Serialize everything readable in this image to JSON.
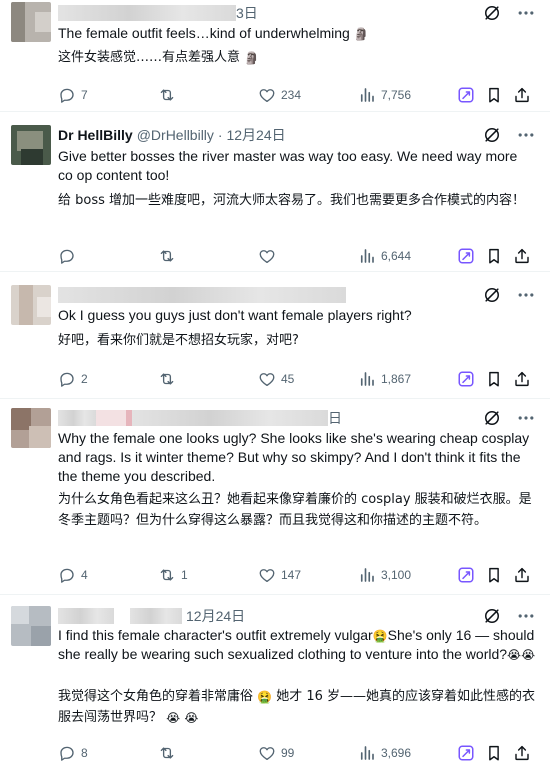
{
  "colors": {
    "text": "#0f1419",
    "muted": "#536471",
    "grok": "#7856ff",
    "divider": "#eff3f4"
  },
  "icons": {
    "more": "more-dots-icon",
    "grok": "grok-icon",
    "reply": "reply-icon",
    "repost": "repost-icon",
    "like": "like-icon",
    "views": "views-icon",
    "bookmark": "bookmark-icon",
    "share": "share-icon",
    "crying": "crying-face-emoji",
    "nauseated": "nauseated-face-emoji",
    "moai": "moai-emoji"
  },
  "posts": [
    {
      "author": "",
      "handle": "",
      "date": "3日",
      "text_en": "The female outfit feels…kind of underwhelming",
      "text_zh": "这件女装感觉……有点差强人意",
      "replies": "7",
      "reposts": "",
      "likes": "234",
      "views": "7,756"
    },
    {
      "author": "Dr HellBilly",
      "handle": "@DrHellbilly",
      "date": "· 12月24日",
      "text_en": "Give better bosses the river master was way too easy. We need way more co op content too!",
      "text_zh": "给 boss 增加一些难度吧，河流大师太容易了。我们也需要更多合作模式的内容！",
      "replies": "",
      "reposts": "",
      "likes": "",
      "views": "6,644"
    },
    {
      "author": "",
      "handle": "",
      "date": "",
      "text_en": "Ok I guess you guys just don't want female players right?",
      "text_zh": "好吧，看来你们就是不想招女玩家，对吧?",
      "replies": "2",
      "reposts": "",
      "likes": "45",
      "views": "1,867"
    },
    {
      "author": "",
      "handle": "",
      "date": "日",
      "text_en": "Why the female one looks ugly? She looks like she's wearing cheap cosplay and rags. Is it winter theme? But why so skimpy? And I don't think it fits the the theme you described.",
      "text_zh": "为什么女角色看起来这么丑？她看起来像穿着廉价的 cosplay 服装和破烂衣服。是冬季主题吗？但为什么穿得这么暴露？而且我觉得这和你描述的主题不符。",
      "replies": "4",
      "reposts": "1",
      "likes": "147",
      "views": "3,100"
    },
    {
      "author": "",
      "handle": "",
      "date": "12月24日",
      "text_en_a": "I find this female character's outfit extremely vulgar",
      "text_en_b": "She's only 16 — should she really be wearing such sexualized clothing to venture into the world?",
      "text_zh_a": "我觉得这个女角色的穿着非常庸俗",
      "text_zh_b": " 她才 16 岁——她真的应该穿着如此性感的衣服去闯荡世界吗？",
      "replies": "8",
      "reposts": "",
      "likes": "99",
      "views": "3,696"
    }
  ]
}
